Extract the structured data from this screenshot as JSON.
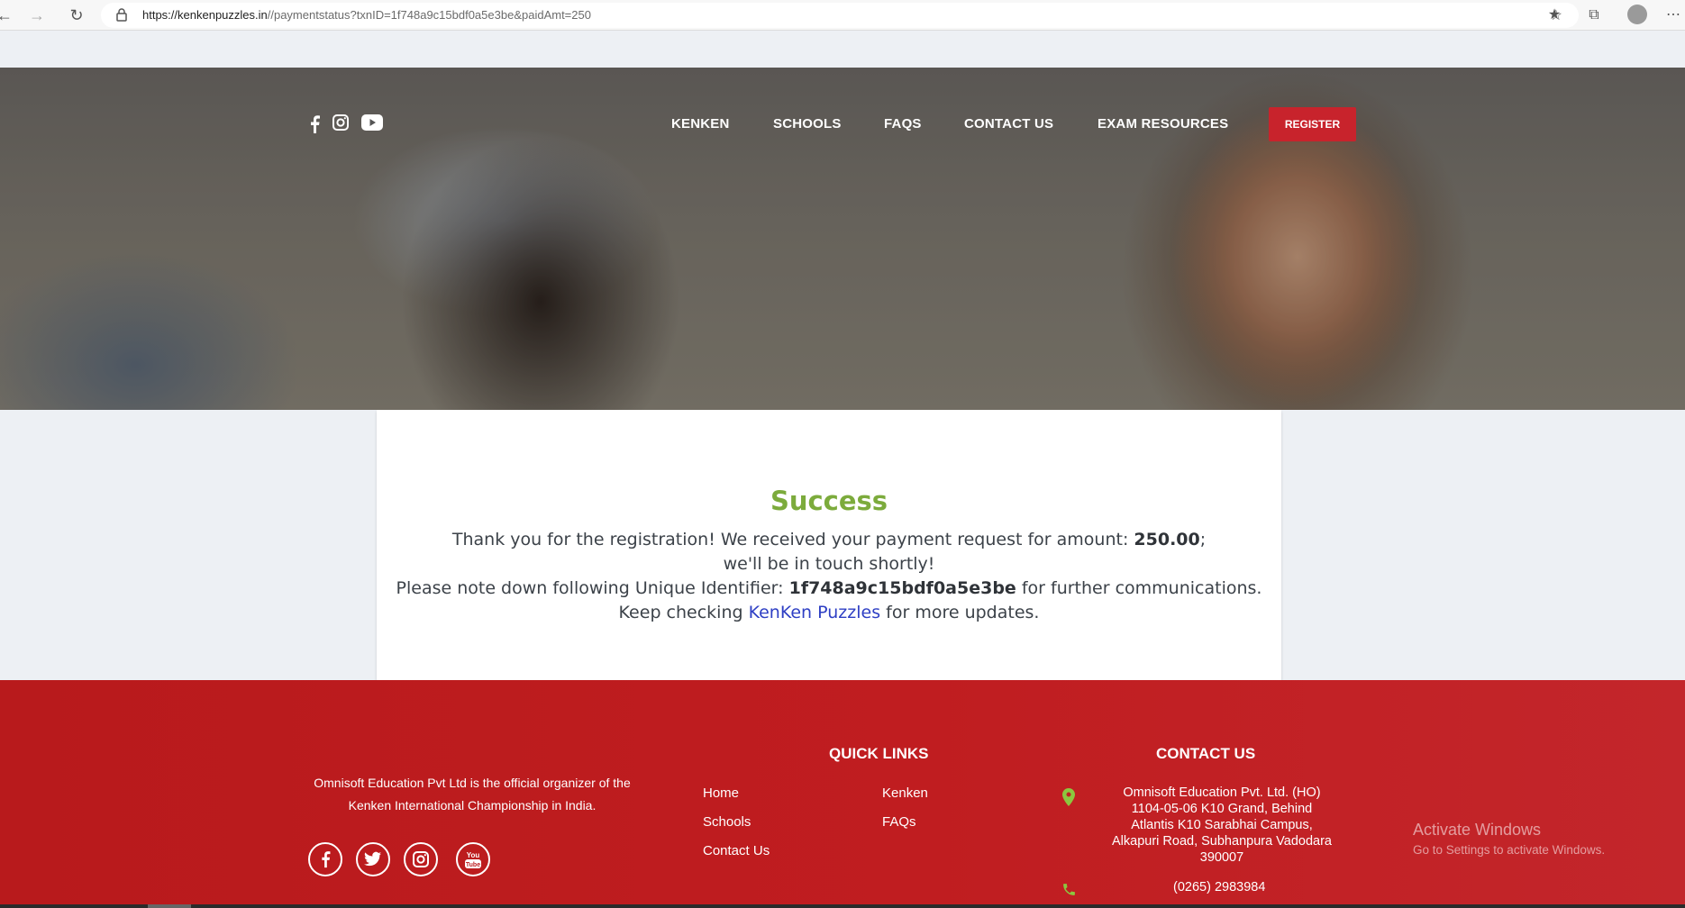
{
  "browser": {
    "url_host": "https://kenkenpuzzles.in",
    "url_path": "//paymentstatus?txnID=1f748a9c15bdf0a5e3be&paidAmt=250"
  },
  "nav": {
    "items": [
      "KENKEN",
      "SCHOOLS",
      "FAQS",
      "CONTACT US",
      "EXAM RESOURCES"
    ],
    "register_label": "REGISTER"
  },
  "status": {
    "title": "Success",
    "line1_prefix": "Thank you for the registration! We received your payment request for amount: ",
    "amount": "250.00",
    "line1_suffix": ";",
    "line2": "we'll be in touch shortly!",
    "line3_prefix": "Please note down following Unique Identifier: ",
    "identifier": "1f748a9c15bdf0a5e3be",
    "line3_suffix": " for further communications.",
    "line4_prefix": "Keep checking ",
    "link_text": "KenKen Puzzles",
    "line4_suffix": " for more updates."
  },
  "footer": {
    "about_line1": "Omnisoft Education Pvt Ltd is the official organizer of the",
    "about_line2": "Kenken International Championship in India.",
    "quick_links_title": "QUICK LINKS",
    "quick_links": [
      "Home",
      "Schools",
      "Contact Us",
      "Kenken",
      "FAQs"
    ],
    "contact_title": "CONTACT US",
    "address": [
      "Omnisoft Education Pvt. Ltd. (HO)",
      "1104-05-06 K10 Grand, Behind",
      "Atlantis K10 Sarabhai Campus,",
      "Alkapuri Road, Subhanpura Vadodara",
      "390007"
    ],
    "phone": "(0265) 2983984"
  },
  "watermark": {
    "line1": "Activate Windows",
    "line2": "Go to Settings to activate Windows."
  },
  "colors": {
    "accent_red": "#c8232c",
    "success_green": "#7cab3c",
    "link_blue": "#2e3fc4",
    "footer_red": "#bd1c1f"
  }
}
